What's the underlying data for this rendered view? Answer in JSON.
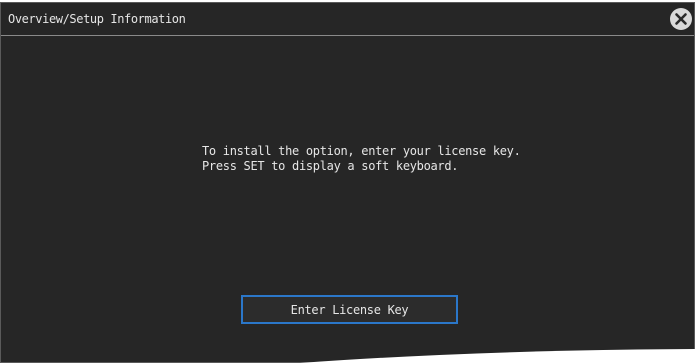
{
  "dialog": {
    "title": "Overview/Setup Information",
    "close_icon": "close-icon"
  },
  "message": {
    "line1": "To install the option, enter your license key.",
    "line2": "Press SET to display a soft keyboard."
  },
  "license_button": {
    "label": "Enter License Key"
  },
  "colors": {
    "background": "#262626",
    "text": "#e6e6e6",
    "accent_border": "#2b77c9",
    "close_button": "#d9d9d9"
  }
}
